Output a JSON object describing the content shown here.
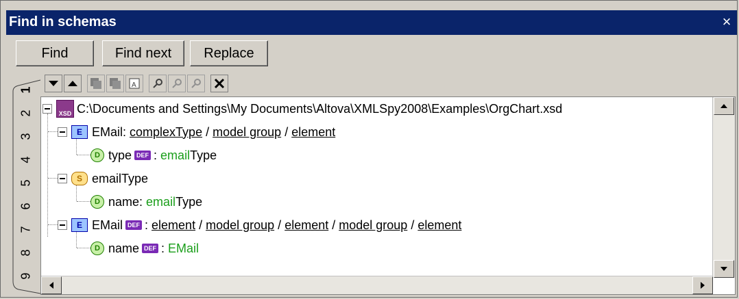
{
  "window": {
    "title": "Find in schemas",
    "close_glyph": "×"
  },
  "buttons": {
    "find": "Find",
    "find_next": "Find next",
    "replace": "Replace"
  },
  "toolbar_icons": [
    "arrow-down-icon",
    "arrow-up-icon",
    "copy-icon",
    "paste-icon",
    "find-in-file-icon",
    "search-icon",
    "find-prev-icon",
    "find-next-icon",
    "clear-icon"
  ],
  "tabs": [
    "1",
    "2",
    "3",
    "4",
    "5",
    "6",
    "7",
    "8",
    "9"
  ],
  "tree": {
    "root": "C:\\Documents and Settings\\My Documents\\Altova\\XMLSpy2008\\Examples\\OrgChart.xsd",
    "xsd_badge": "XSD",
    "r1": {
      "name": "EMail",
      "p1": "complexType",
      "p2": "model group",
      "p3": "element"
    },
    "r2": {
      "name": "type",
      "def": "DEF",
      "hl": "email",
      "rest": "Type"
    },
    "r3": {
      "name": "emailType"
    },
    "r4": {
      "name": "name:",
      "hl": "email",
      "rest": "Type"
    },
    "r5": {
      "name": "EMail",
      "def": "DEF",
      "p1": "element",
      "p2": "model group",
      "p3": "element",
      "p4": "model group",
      "p5": "element"
    },
    "r6": {
      "name": "name",
      "def": "DEF",
      "hl": "EMail"
    }
  },
  "badges": {
    "E": "E",
    "S": "S",
    "D": "D"
  }
}
